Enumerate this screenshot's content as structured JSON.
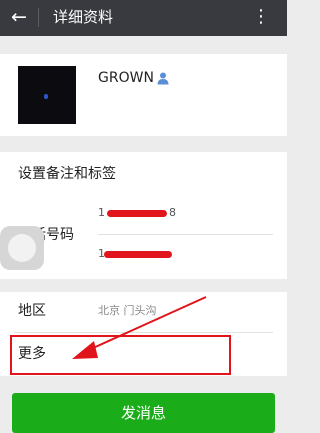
{
  "topbar": {
    "back_glyph": "←",
    "title": "详细资料",
    "more_glyph": "⋮"
  },
  "profile": {
    "name": "GROWN",
    "gender_icon": "male-user-icon"
  },
  "remark": {
    "label": "设置备注和标签"
  },
  "phone": {
    "label": "电话号码",
    "number_1": "1",
    "number_1_tail": "8",
    "number_2": "1"
  },
  "region": {
    "label": "地区",
    "value": "北京  门头沟"
  },
  "more": {
    "label": "更多"
  },
  "actions": {
    "send_label": "发消息"
  },
  "colors": {
    "topbar": "#393a3f",
    "send_green": "#1aad19",
    "annotation_red": "#e0141a",
    "background": "#ececec"
  }
}
